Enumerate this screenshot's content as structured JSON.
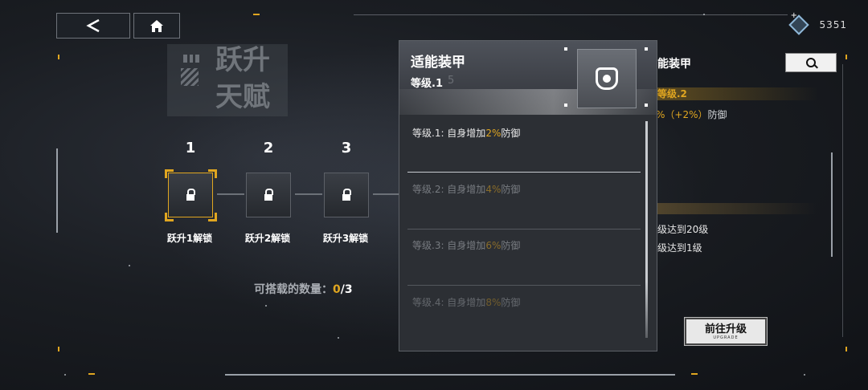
{
  "top": {
    "back_icon": "chevron-left-icon",
    "home_icon": "home-icon",
    "currency_icon": "crystal-icon",
    "currency_value": "5351",
    "add_icon": "plus-icon"
  },
  "title": {
    "line1": "跃升",
    "line2": "天赋"
  },
  "slots": [
    {
      "num": "1",
      "label": "跃升1解锁",
      "state": "locked-selected"
    },
    {
      "num": "2",
      "label": "跃升2解锁",
      "state": "locked"
    },
    {
      "num": "3",
      "label": "跃升3解锁",
      "state": "locked"
    }
  ],
  "capacity": {
    "label": "可搭载的数量：",
    "current": "0",
    "sep": "/",
    "total": "3"
  },
  "panel": {
    "title": "适能装甲",
    "level": "等级.1",
    "ghost": "5",
    "icon": "armor-shield-icon",
    "rows": [
      {
        "pre": "等级.1: 自身增加",
        "val": "2%",
        "post": "防御"
      },
      {
        "pre": "等级.2: 自身增加",
        "val": "4%",
        "post": "防御"
      },
      {
        "pre": "等级.3: 自身增加",
        "val": "6%",
        "post": "防御"
      },
      {
        "pre": "等级.4: 自身增加",
        "val": "8%",
        "post": "防御"
      }
    ]
  },
  "right": {
    "title": "能装甲",
    "search_icon": "magnifier-icon",
    "level": "等级.2",
    "desc_pre": "%（+2%）",
    "desc_post": "防御",
    "cond1": "级达到20级",
    "cond2": "级达到1级",
    "upgrade_label": "前往升级",
    "upgrade_sub": "UPGRADE"
  },
  "colors": {
    "accent": "#e0a620",
    "panel": "#2b2e33"
  }
}
